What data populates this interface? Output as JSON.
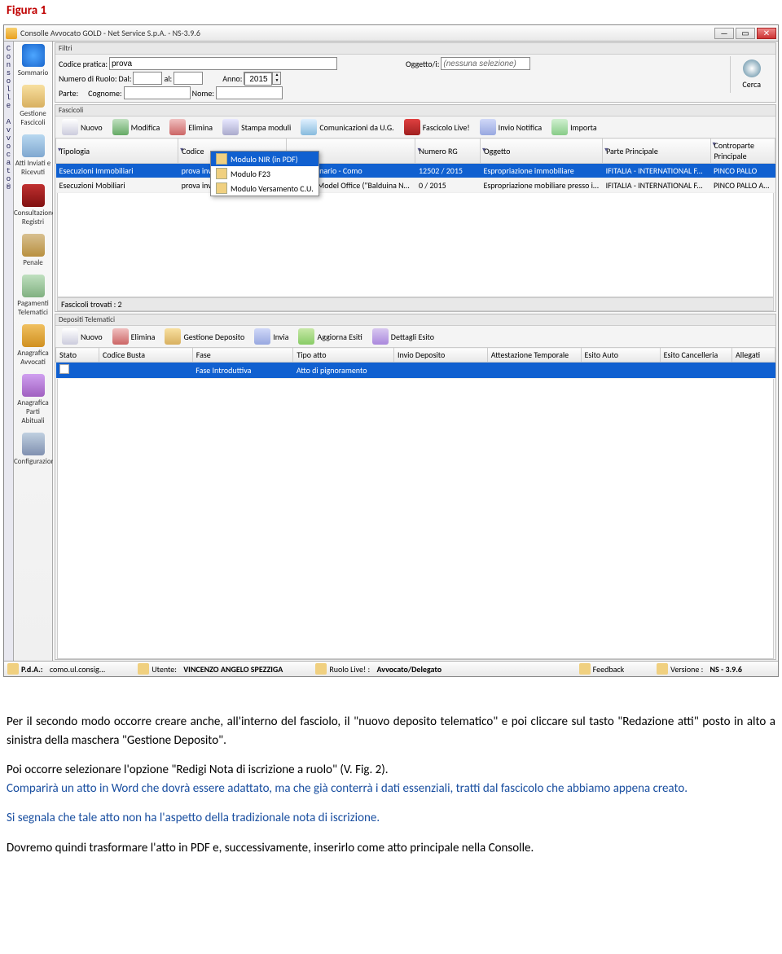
{
  "figure_label": "Figura 1",
  "window": {
    "title": "Consolle Avvocato GOLD - Net Service S.p.A. - NS-3.9.6"
  },
  "rail_label": "Consolle Avvocato®",
  "nav": [
    {
      "label": "Sommario"
    },
    {
      "label": "Gestione Fascicoli"
    },
    {
      "label": "Atti Inviati e Ricevuti"
    },
    {
      "label": "Consultazione Registri"
    },
    {
      "label": "Penale"
    },
    {
      "label": "Pagamenti Telematici"
    },
    {
      "label": "Anagrafica Avvocati"
    },
    {
      "label": "Anagrafica Parti Abituali"
    },
    {
      "label": "Configurazione"
    }
  ],
  "filtri": {
    "title": "Filtri",
    "codice_label": "Codice pratica:",
    "codice_value": "prova",
    "oggetto_label": "Oggetto/i:",
    "oggetto_value": "(nessuna selezione)",
    "ruolo_label": "Numero di Ruolo:",
    "dal_label": "Dal:",
    "al_label": "al:",
    "anno_label": "Anno:",
    "anno_value": "2015",
    "parte_label": "Parte:",
    "cognome_label": "Cognome:",
    "nome_label": "Nome:",
    "cerca_label": "Cerca"
  },
  "fascicoli": {
    "title": "Fascicoli",
    "toolbar": {
      "nuovo": "Nuovo",
      "modifica": "Modifica",
      "elimina": "Elimina",
      "stampa": "Stampa moduli",
      "comunic": "Comunicazioni da U.G.",
      "live": "Fascicolo Live!",
      "invio": "Invio Notifica",
      "importa": "Importa"
    },
    "columns": [
      "Tipologia",
      "Codice",
      "",
      "Numero RG",
      "Oggetto",
      "Parte Principale",
      "Controparte Principale"
    ],
    "rows": [
      {
        "tip": "Esecuzioni Immobiliari",
        "cod": "prova invio titoli re IM",
        "uff": "nale Ordinario - Como",
        "rg": "12502 / 2015",
        "ogg": "Espropriazione immobiliare",
        "pp": "IFITALIA - INTERNATIONAL FACTORS ITALIA S...",
        "cp": "PINCO PALLO"
      },
      {
        "tip": "Esecuzioni Mobiliari",
        "cod": "prova invio titoli RE MO",
        "uff": "unale di Model Office (\"Balduina New\")",
        "rg": "0 / 2015",
        "ogg": "Espropriazione mobiliare presso il debitore",
        "pp": "IFITALIA - INTERNATIONAL FACTORS ITALIA S...",
        "cp": "PINCO PALLO ASSOCIATION"
      }
    ],
    "trovati": "Fascicoli trovati : 2"
  },
  "context_menu": {
    "items": [
      "Modulo NIR (in PDF)",
      "Modulo F23",
      "Modulo Versamento C.U."
    ]
  },
  "depositi": {
    "title": "Depositi Telematici",
    "toolbar": {
      "nuovo": "Nuovo",
      "elimina": "Elimina",
      "gestione": "Gestione Deposito",
      "invia": "Invia",
      "aggiorna": "Aggiorna Esiti",
      "dettagli": "Dettagli Esito"
    },
    "columns": [
      "Stato",
      "Codice Busta",
      "Fase",
      "Tipo atto",
      "Invio Deposito",
      "Attestazione Temporale",
      "Esito Auto",
      "Esito Cancelleria",
      "Allegati"
    ],
    "row": {
      "stato": "",
      "busta": "",
      "fase": "Fase Introduttiva",
      "tipo": "Atto di pignoramento"
    }
  },
  "footer": {
    "pda_label": "P.d.A.:",
    "pda_value": "como.ul.consig...",
    "utente_label": "Utente:",
    "utente_value": "VINCENZO ANGELO SPEZZIGA",
    "ruolo_label": "Ruolo Live! :",
    "ruolo_value": "Avvocato/Delegato",
    "feedback": "Feedback",
    "versione_label": "Versione :",
    "versione_value": "NS - 3.9.6"
  },
  "body_text": {
    "p1": "Per il secondo modo occorre creare anche, all'interno del fasciolo, il \"nuovo deposito telematico\" e poi cliccare sul tasto \"Redazione atti\" posto in alto a sinistra della maschera \"Gestione Deposito\".",
    "p2a": "Poi occorre selezionare l'opzione \"Redigi Nota di iscrizione a ruolo\" (V. Fig. 2).",
    "p2b": "Comparirà un atto in Word che dovrà essere adattato, ma che già conterrà i dati essenziali, tratti dal fascicolo che abbiamo appena creato.",
    "p3": "Si segnala che tale atto non ha l'aspetto della tradizionale nota di iscrizione.",
    "p4": "Dovremo quindi trasformare l'atto in PDF e, successivamente, inserirlo come atto principale nella Consolle."
  }
}
